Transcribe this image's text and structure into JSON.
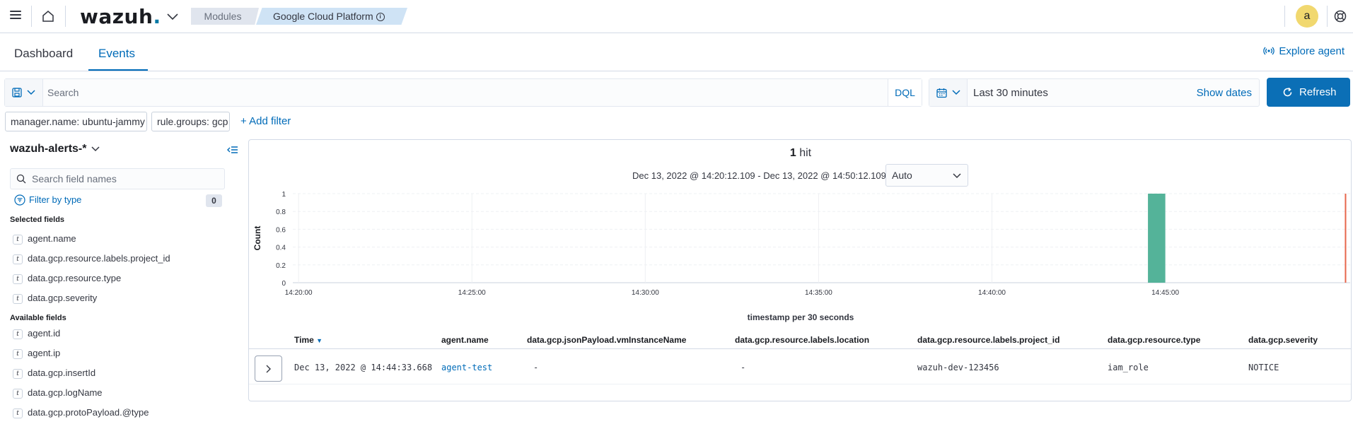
{
  "topbar": {
    "logo": "wazuh",
    "logo_dot": ".",
    "crumbs": [
      "Modules",
      "Google Cloud Platform"
    ],
    "avatar_letter": "a"
  },
  "tabs": [
    "Dashboard",
    "Events"
  ],
  "active_tab": "Events",
  "explore_agent": "Explore agent",
  "query": {
    "placeholder": "Search",
    "value": "",
    "language": "DQL"
  },
  "date": {
    "range": "Last 30 minutes",
    "show_dates": "Show dates"
  },
  "refresh_label": "Refresh",
  "filters": [
    "manager.name: ubuntu-jammy",
    "rule.groups: gcp"
  ],
  "add_filter": "+ Add filter",
  "sidebar": {
    "index_pattern": "wazuh-alerts-*",
    "field_search_placeholder": "Search field names",
    "filter_by_type": "Filter by type",
    "filter_count": "0",
    "selected_title": "Selected fields",
    "selected_fields": [
      "agent.name",
      "data.gcp.resource.labels.project_id",
      "data.gcp.resource.type",
      "data.gcp.severity"
    ],
    "available_title": "Available fields",
    "available_fields": [
      "agent.id",
      "agent.ip",
      "data.gcp.insertId",
      "data.gcp.logName",
      "data.gcp.protoPayload.@type"
    ],
    "type_badge": "t"
  },
  "histogram": {
    "hits_count": "1",
    "hits_label": "hit",
    "range": "Dec 13, 2022 @ 14:20:12.109 - Dec 13, 2022 @ 14:50:12.109",
    "interval": "Auto",
    "x_title": "timestamp per 30 seconds"
  },
  "chart_data": {
    "type": "bar",
    "ylabel": "Count",
    "xlabel": "timestamp per 30 seconds",
    "ylim": [
      0,
      1
    ],
    "y_ticks": [
      "0",
      "0.2",
      "0.4",
      "0.6",
      "0.8",
      "1"
    ],
    "x_ticks": [
      "14:20:00",
      "14:25:00",
      "14:30:00",
      "14:35:00",
      "14:40:00",
      "14:45:00"
    ],
    "bars": [
      {
        "x": "14:44:30",
        "value": 1
      }
    ],
    "now_marker": "14:50:12",
    "bar_color": "#54b399",
    "marker_color": "#e7664c",
    "grid": true
  },
  "table": {
    "columns": [
      "Time",
      "agent.name",
      "data.gcp.jsonPayload.vmInstanceName",
      "data.gcp.resource.labels.location",
      "data.gcp.resource.labels.project_id",
      "data.gcp.resource.type",
      "data.gcp.severity"
    ],
    "rows": [
      [
        "Dec 13, 2022 @ 14:44:33.668",
        "agent-test",
        "-",
        "-",
        "wazuh-dev-123456",
        "iam_role",
        "NOTICE"
      ]
    ]
  },
  "colors": {
    "accent": "#006bb8",
    "primary_button": "#0b6fb6",
    "avatar": "#f1d86f"
  }
}
